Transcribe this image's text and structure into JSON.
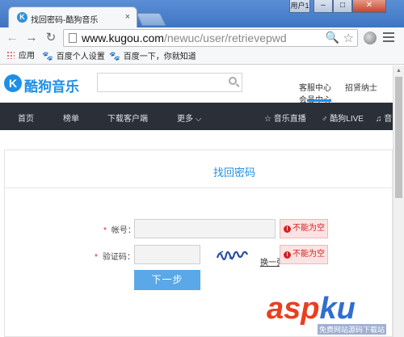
{
  "browser": {
    "tab_title": "找回密码-酷狗音乐",
    "tab_favicon": "K",
    "tab_close": "×",
    "window_user": "用户1",
    "win_min": "–",
    "win_max": "□",
    "win_close": "✕",
    "nav_back": "←",
    "nav_forward": "→",
    "nav_reload": "↻",
    "url_host": "www.kugou.com",
    "url_path": "/newuc/user/retrievepwd",
    "zoom_icon": "🔍",
    "star_icon": "☆",
    "bookmarks": [
      {
        "label": "应用"
      },
      {
        "label": "百度个人设置"
      },
      {
        "label": "百度一下，你就知道"
      }
    ],
    "paw_glyph": "🐾"
  },
  "header": {
    "logo_mark": "K",
    "logo_text": "酷狗音乐",
    "search_placeholder": "",
    "links": {
      "service": "客服中心",
      "jobs": "招贤纳士",
      "vip": "会员中心"
    }
  },
  "nav": {
    "home": "首页",
    "charts": "榜单",
    "download": "下载客户端",
    "more": "更多 ⌵",
    "live": "☆ 音乐直播",
    "kugou_live": "♂ 酷狗LIVE",
    "last": "♫ 音"
  },
  "form": {
    "title": "找回密码",
    "required_mark": "*",
    "account_label": "帐号：",
    "captcha_label": "验证码：",
    "account_value": "",
    "captcha_value": "",
    "error_icon": "!",
    "account_error": "不能为空",
    "captcha_error": "不能为空",
    "swap_link": "换一张",
    "next_button": "下一步"
  },
  "watermark": {
    "part_a": "asp",
    "part_b": "ku",
    "sub": "免费网站源码下载站"
  },
  "colors": {
    "accent": "#1f8fe6",
    "nav_bg": "#2a2f38",
    "error": "#d42020",
    "button": "#5aa8e8"
  }
}
